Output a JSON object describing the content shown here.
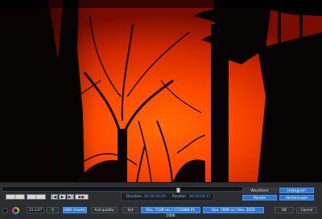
{
  "colors": {
    "accent": "#2a78d6",
    "sky_orange": "#ff4a00",
    "panel_bg": "#2b2d30"
  },
  "transport": {
    "buttons": [
      {
        "name": "start-marker-button",
        "label": "|"
      },
      {
        "name": "end-marker-button",
        "label": "|"
      },
      {
        "name": "prev-frame-button",
        "label": "|◀"
      },
      {
        "name": "play-button",
        "label": "▶"
      },
      {
        "name": "next-frame-button",
        "label": "▶|"
      },
      {
        "name": "last-frame-button",
        "label": "▶▶"
      }
    ]
  },
  "timecode": {
    "duration_label": "Duration",
    "duration_value": "00:00:00.00",
    "position_label": "Position",
    "position_value": "00:00:09.17"
  },
  "view_toggles": {
    "waveform": "Waveform",
    "histogram": "Histogram",
    "parade": "Parade",
    "vectorscope": "Vectorscope"
  },
  "bottom_bar": {
    "zoom_value": "33.1/27",
    "zoom_suffix": "5",
    "hdr_mode": "HDR (mode)",
    "full_quality": "Full quality",
    "set_button": "Set",
    "res_info_a": "Res. 7338 res / 1732888 P1 1000",
    "res_info_b": "Res. 7999 ro / Res. 2020",
    "ok_button": "OK",
    "cancel_button": "Cancel"
  }
}
